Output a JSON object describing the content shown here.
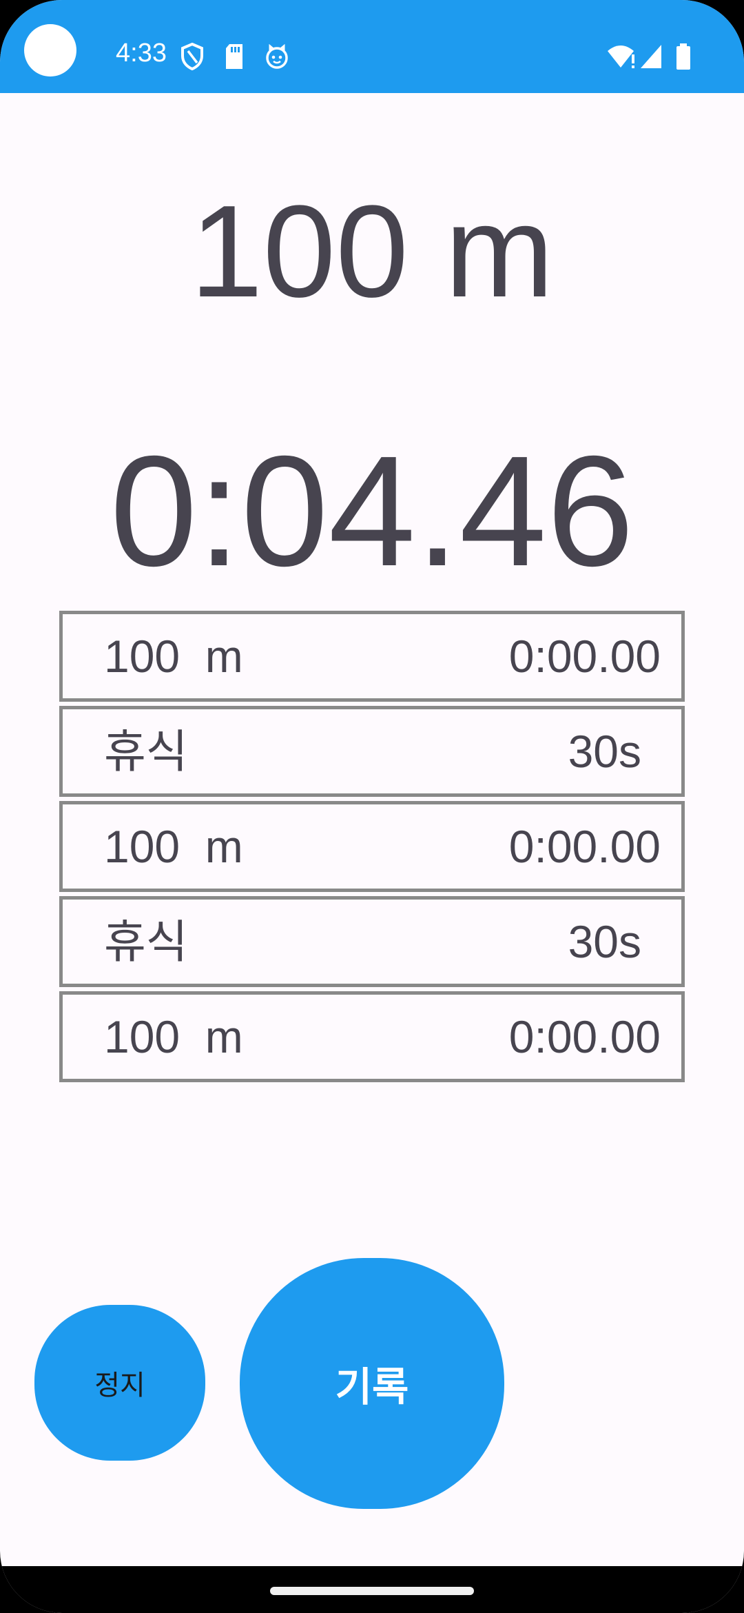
{
  "status_bar": {
    "time": "4:33",
    "background_color": "#1e9bef",
    "icons": [
      "shield-icon",
      "sdcard-icon",
      "cat-icon",
      "wifi-alert-icon",
      "signal-icon",
      "battery-icon"
    ]
  },
  "main": {
    "distance": "100 m",
    "timer": "0:04.46"
  },
  "intervals": [
    {
      "label": "100  m",
      "value": "0:00.00",
      "type": "swim"
    },
    {
      "label": "휴식",
      "value": "30s",
      "type": "rest"
    },
    {
      "label": "100  m",
      "value": "0:00.00",
      "type": "swim"
    },
    {
      "label": "휴식",
      "value": "30s",
      "type": "rest"
    },
    {
      "label": "100  m",
      "value": "0:00.00",
      "type": "swim"
    }
  ],
  "buttons": {
    "stop_label": "정지",
    "record_label": "기록"
  },
  "colors": {
    "accent": "#1e9bef",
    "text": "#47444f",
    "background": "#fefafe",
    "row_border": "#898989"
  }
}
